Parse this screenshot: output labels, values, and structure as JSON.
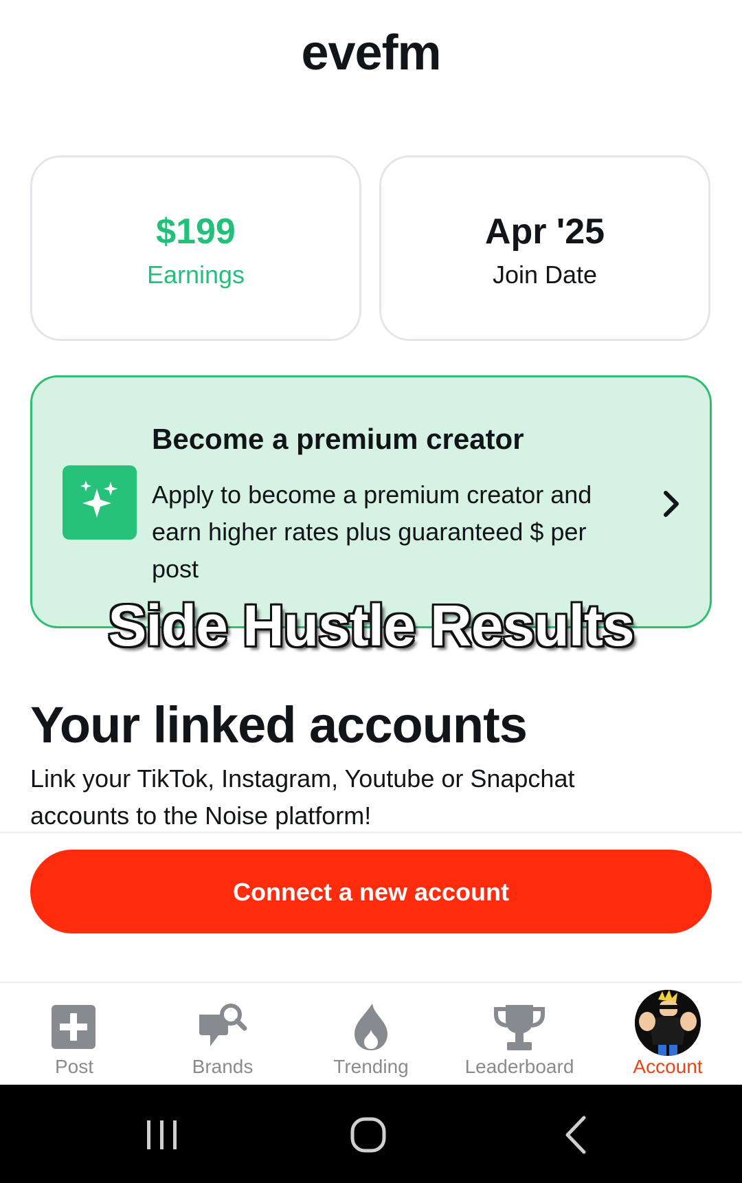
{
  "header": {
    "username": "evefm"
  },
  "stats": {
    "earnings": {
      "value": "$199",
      "label": "Earnings"
    },
    "join_date": {
      "value": "Apr '25",
      "label": "Join Date"
    }
  },
  "premium": {
    "title": "Become a premium creator",
    "description": "Apply to become a premium creator and earn higher rates plus guaranteed $ per post",
    "icon": "sparkles-icon"
  },
  "overlay": {
    "caption": "Side Hustle Results"
  },
  "linked": {
    "heading": "Your linked accounts",
    "description": "Link your TikTok, Instagram, Youtube or Snapchat accounts to the Noise platform!",
    "connect_label": "Connect a new account"
  },
  "tabs": [
    {
      "label": "Post",
      "icon": "plus-square-icon"
    },
    {
      "label": "Brands",
      "icon": "brand-search-icon"
    },
    {
      "label": "Trending",
      "icon": "flame-icon"
    },
    {
      "label": "Leaderboard",
      "icon": "trophy-icon"
    },
    {
      "label": "Account",
      "icon": "avatar",
      "active": true
    }
  ],
  "colors": {
    "accent_green": "#22c07a",
    "connect_red": "#fe2c0d",
    "active_tab": "#f0420f",
    "inactive_tab": "#888c90",
    "premium_bg": "#d6f2e3"
  }
}
